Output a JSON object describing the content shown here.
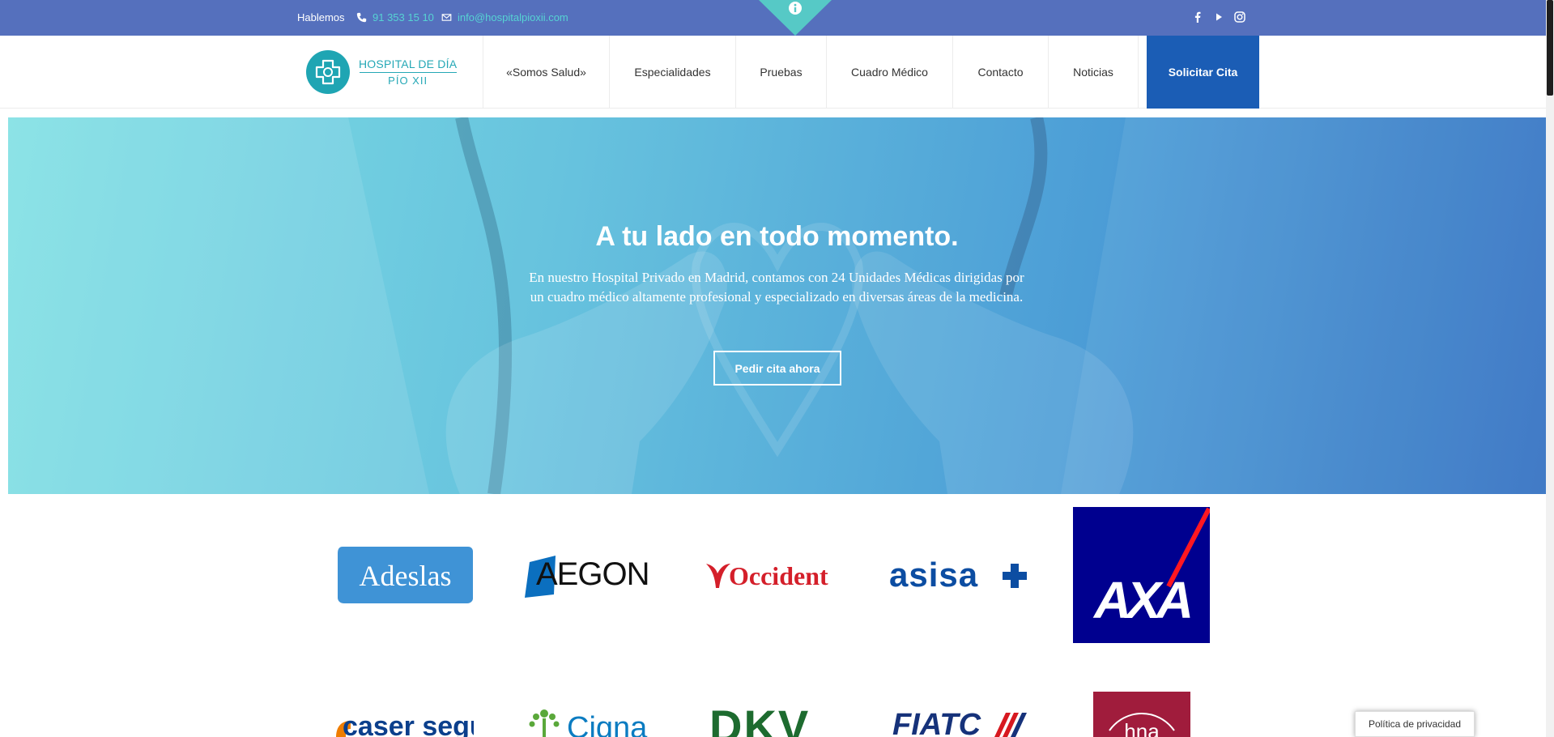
{
  "topbar": {
    "label": "Hablemos",
    "phone": "91 353 15 10",
    "email": "info@hospitalpioxii.com",
    "social_icons": [
      "facebook-icon",
      "youtube-icon",
      "instagram-icon"
    ]
  },
  "header": {
    "logo": {
      "line1": "HOSPITAL DE DÍA",
      "line2": "PÍO XII"
    },
    "nav": [
      "«Somos Salud»",
      "Especialidades",
      "Pruebas",
      "Cuadro Médico",
      "Contacto",
      "Noticias"
    ],
    "cta": "Solicitar Cita"
  },
  "hero": {
    "title": "A tu lado en todo momento.",
    "text": "En nuestro Hospital Privado en Madrid, contamos con 24 Unidades Médicas dirigidas por un cuadro médico altamente profesional y especializado en diversas áreas de la medicina.",
    "button": "Pedir cita ahora"
  },
  "insurers": {
    "row1": [
      "Adeslas",
      "AEGON",
      "Occident",
      "asisa",
      "AXA"
    ],
    "row2": [
      "caser seguros",
      "Cigna",
      "DKV",
      "FIATC",
      "hna"
    ]
  },
  "privacy": "Política de privacidad",
  "colors": {
    "topbar": "#5570bd",
    "accent_teal": "#56d3d3",
    "cta_blue": "#1b5db5",
    "logo_teal": "#25a8b6"
  }
}
